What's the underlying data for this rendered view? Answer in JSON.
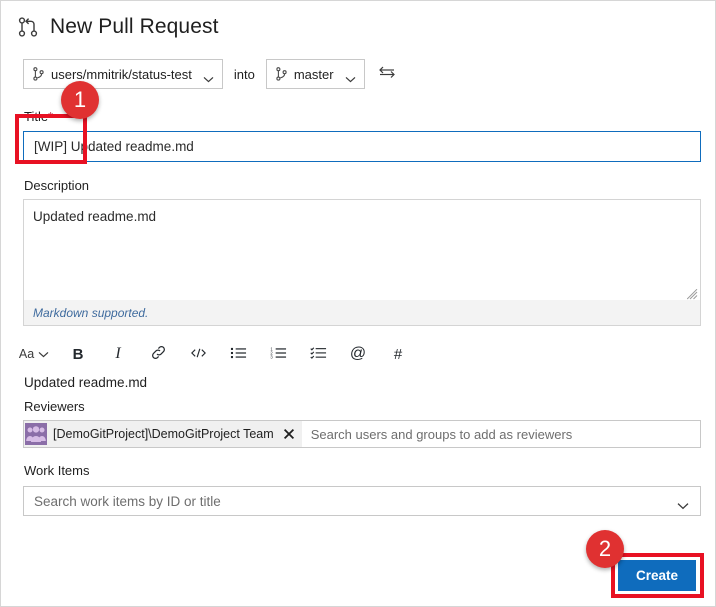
{
  "header": {
    "title": "New Pull Request",
    "icon": "pull-request-icon"
  },
  "branches": {
    "source": "users/mmitrik/status-test",
    "into_label": "into",
    "target": "master",
    "swap_icon": "swap-arrows-icon",
    "branch_icon": "branch-icon",
    "chevron_icon": "chevron-down-icon"
  },
  "title_field": {
    "label": "Title",
    "required_marker": "*",
    "value": "[WIP] Updated readme.md",
    "highlighted_prefix": "[WIP]"
  },
  "description_field": {
    "label": "Description",
    "value": "Updated readme.md",
    "footer_note": "Markdown supported.",
    "resize_handle": "resize-grip-icon"
  },
  "markdown_toolbar": {
    "buttons": [
      {
        "name": "font-size-button",
        "label": "Aa",
        "icon": "chevron-down-icon"
      },
      {
        "name": "bold-button",
        "label": "B",
        "icon": "bold-icon"
      },
      {
        "name": "italic-button",
        "label": "I",
        "icon": "italic-icon"
      },
      {
        "name": "link-button",
        "label": "",
        "icon": "link-icon"
      },
      {
        "name": "code-button",
        "label": "",
        "icon": "code-icon"
      },
      {
        "name": "bulleted-list-button",
        "label": "",
        "icon": "bulleted-list-icon"
      },
      {
        "name": "numbered-list-button",
        "label": "",
        "icon": "numbered-list-icon"
      },
      {
        "name": "task-list-button",
        "label": "",
        "icon": "task-list-icon"
      },
      {
        "name": "mention-button",
        "label": "@",
        "icon": "at-mention-icon"
      },
      {
        "name": "hashtag-button",
        "label": "#",
        "icon": "hashtag-icon"
      }
    ]
  },
  "preview": {
    "text": "Updated readme.md"
  },
  "reviewers_field": {
    "label": "Reviewers",
    "chip": {
      "name": "[DemoGitProject]\\DemoGitProject Team",
      "avatar_icon": "group-avatar-icon",
      "remove_icon": "close-icon"
    },
    "placeholder": "Search users and groups to add as reviewers"
  },
  "work_items_field": {
    "label": "Work Items",
    "placeholder": "Search work items by ID or title",
    "chevron_icon": "chevron-down-icon"
  },
  "actions": {
    "create_label": "Create"
  },
  "annotations": {
    "badge_one": "1",
    "badge_two": "2",
    "accent_red": "#e81123",
    "badge_red": "#e03131",
    "accent_blue": "#0f6cbd"
  }
}
